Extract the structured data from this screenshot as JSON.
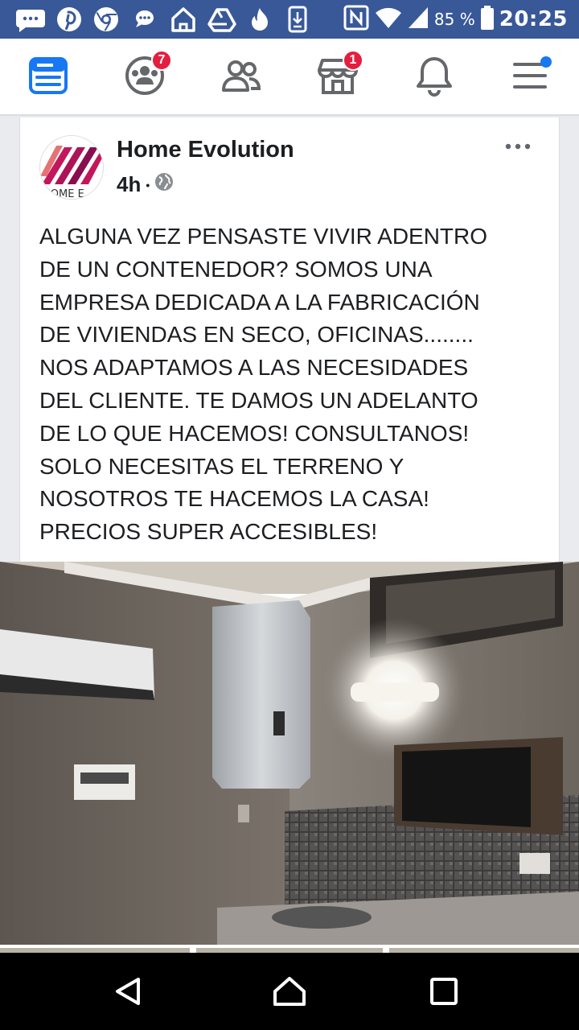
{
  "status_bar": {
    "battery_percent": "85 %",
    "time": "20:25",
    "icons": [
      "messages-icon",
      "pinterest-icon",
      "chrome-icon",
      "chat-icon",
      "home-app-icon",
      "drive-icon",
      "tinder-icon",
      "download-icon",
      "nfc-icon",
      "wifi-icon",
      "signal-icon",
      "battery-icon"
    ]
  },
  "nav": {
    "items": [
      {
        "name": "news-feed-icon",
        "active": true
      },
      {
        "name": "groups-icon",
        "badge": "7"
      },
      {
        "name": "friends-icon"
      },
      {
        "name": "marketplace-icon",
        "badge": "1"
      },
      {
        "name": "notifications-icon"
      },
      {
        "name": "menu-icon"
      }
    ],
    "colors": {
      "active": "#1877f2",
      "inactive": "#65676b",
      "badge": "#e41e3f"
    }
  },
  "post": {
    "page_name": "Home Evolution",
    "time": "4h",
    "separator": "•",
    "avatar_text": "HOME E",
    "text": "ALGUNA VEZ PENSASTE VIVIR ADENTRO\nDE UN CONTENEDOR? SOMOS UNA\nEMPRESA DEDICADA A LA FABRICACIÓN\nDE VIVIENDAS EN SECO, OFICINAS........\nNOS ADAPTAMOS A LAS NECESIDADES\nDEL CLIENTE. TE DAMOS UN ADELANTO\nDE LO QUE HACEMOS!  CONSULTANOS!\nSOLO NECESITAS EL TERRENO Y\nNOSOTROS TE HACEMOS LA CASA!\nPRECIOS SUPER ACCESIBLES!"
  },
  "colors": {
    "status_bar": "#385898",
    "brand": "#1877f2",
    "avatar_stripes": "#c2185b"
  }
}
